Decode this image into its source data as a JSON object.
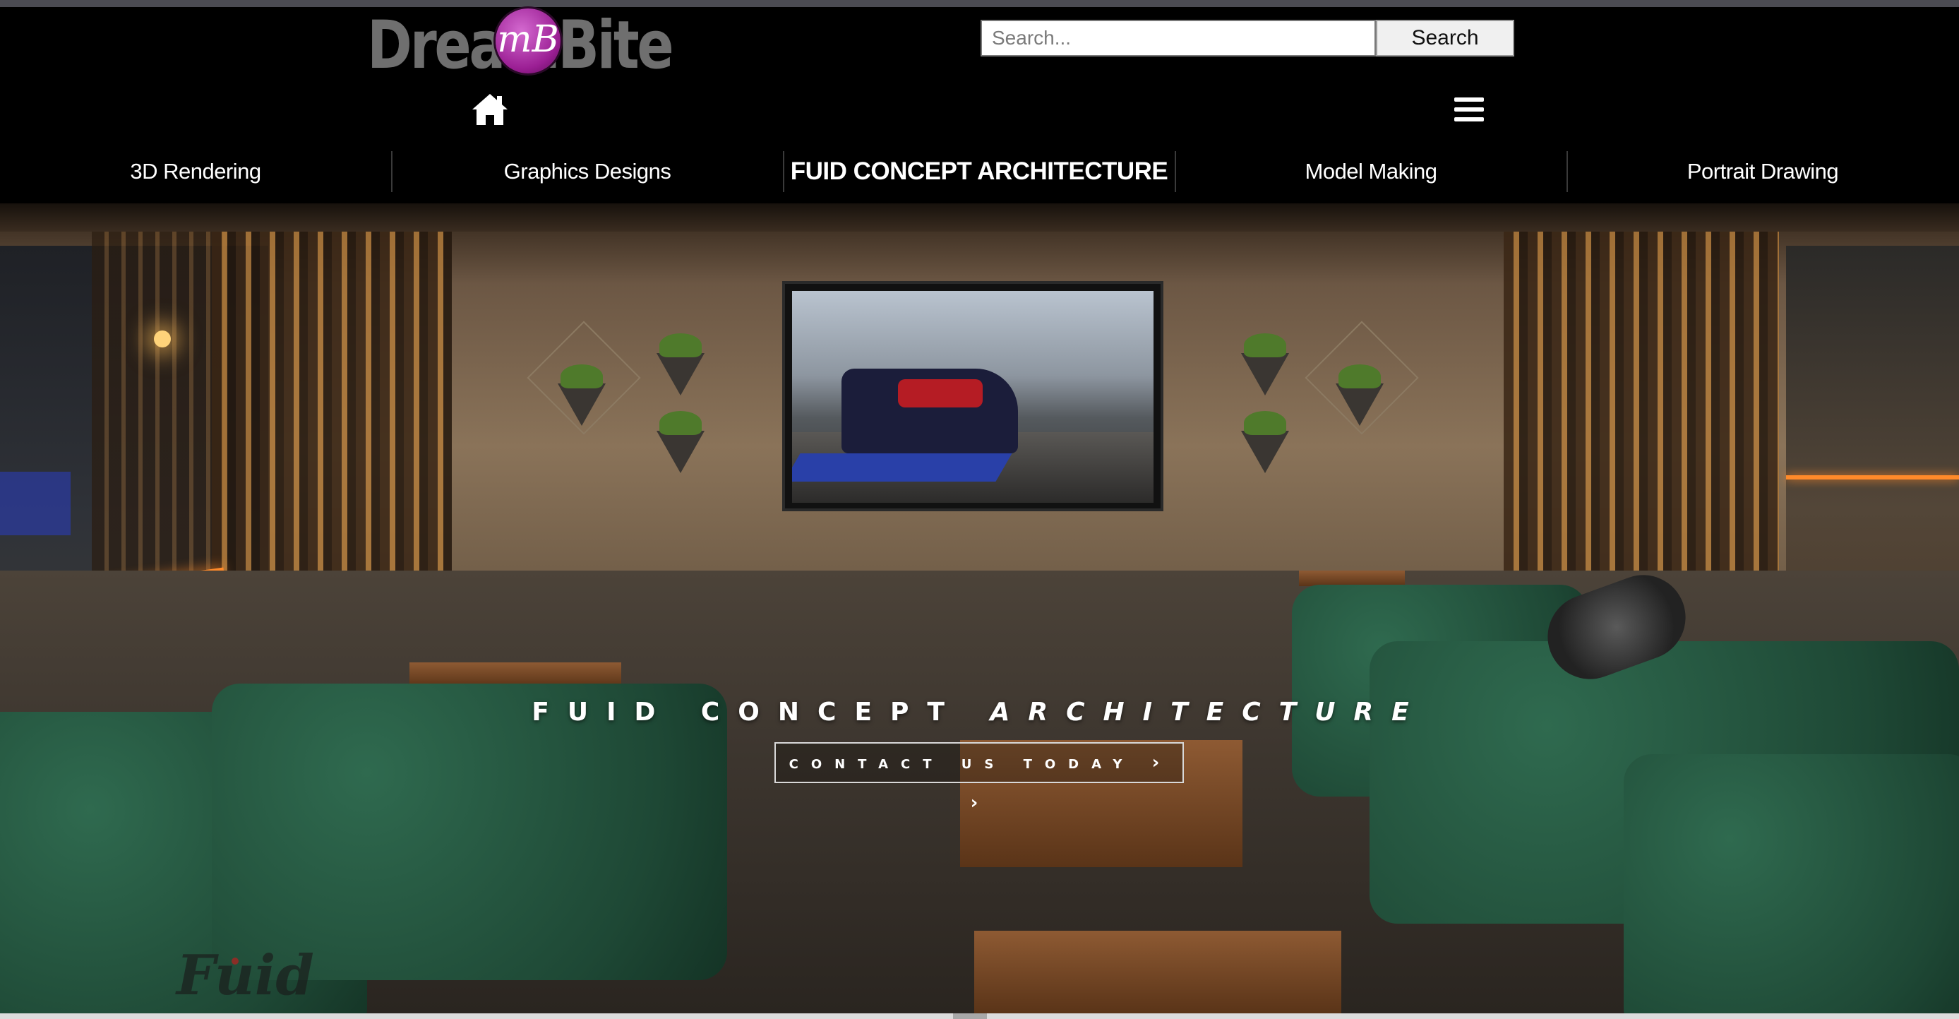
{
  "header": {
    "logo_text": "DreamBite",
    "logo_badge_letters": "mB",
    "search": {
      "placeholder": "Search...",
      "button_label": "Search"
    },
    "icons": {
      "home": "home-icon",
      "menu": "hamburger-menu-icon"
    }
  },
  "nav": {
    "items": [
      {
        "label": "3D Rendering",
        "active": false
      },
      {
        "label": "Graphics Designs",
        "active": false
      },
      {
        "label": "FUID CONCEPT ARCHITECTURE",
        "active": true
      },
      {
        "label": "Model Making",
        "active": false
      },
      {
        "label": "Portrait Drawing",
        "active": false
      }
    ]
  },
  "hero": {
    "title_plain": "FUID CONCEPT",
    "title_italic": "ARCHITECTURE",
    "cta_label": "CONTACT US TODAY",
    "cta_arrows": "› ›",
    "watermark_logo": "Fuid"
  },
  "colors": {
    "header_bg": "#000000",
    "logo_gray": "#6f6f6f",
    "logo_magenta": "#9b1f94",
    "nav_text": "#ffffff",
    "sofa_green": "#1e4835",
    "accent_orange": "#ff8a2a"
  }
}
